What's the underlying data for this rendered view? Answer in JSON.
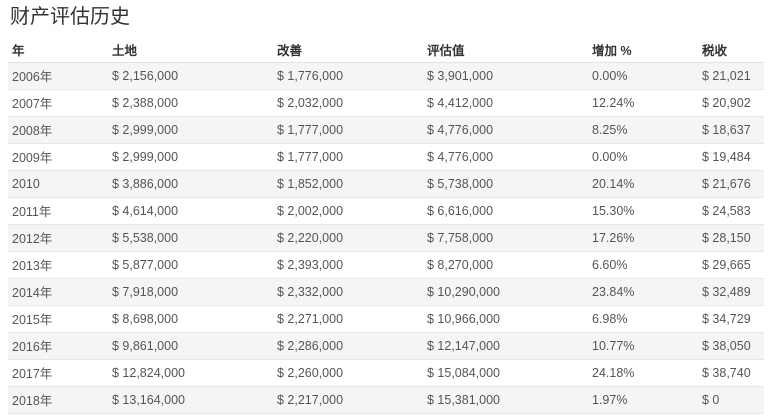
{
  "title": "财产评估历史",
  "columns": [
    "年",
    "土地",
    "改善",
    "评估值",
    "增加 %",
    "税收"
  ],
  "rows": [
    [
      "2006年",
      "$ 2,156,000",
      "$ 1,776,000",
      "$ 3,901,000",
      "0.00%",
      "$ 21,021"
    ],
    [
      "2007年",
      "$ 2,388,000",
      "$ 2,032,000",
      "$ 4,412,000",
      "12.24%",
      "$ 20,902"
    ],
    [
      "2008年",
      "$ 2,999,000",
      "$ 1,777,000",
      "$ 4,776,000",
      "8.25%",
      "$ 18,637"
    ],
    [
      "2009年",
      "$ 2,999,000",
      "$ 1,777,000",
      "$ 4,776,000",
      "0.00%",
      "$ 19,484"
    ],
    [
      "2010",
      "$ 3,886,000",
      "$ 1,852,000",
      "$ 5,738,000",
      "20.14%",
      "$ 21,676"
    ],
    [
      "2011年",
      "$ 4,614,000",
      "$ 2,002,000",
      "$ 6,616,000",
      "15.30%",
      "$ 24,583"
    ],
    [
      "2012年",
      "$ 5,538,000",
      "$ 2,220,000",
      "$ 7,758,000",
      "17.26%",
      "$ 28,150"
    ],
    [
      "2013年",
      "$ 5,877,000",
      "$ 2,393,000",
      "$ 8,270,000",
      "6.60%",
      "$ 29,665"
    ],
    [
      "2014年",
      "$ 7,918,000",
      "$ 2,332,000",
      "$ 10,290,000",
      "23.84%",
      "$ 32,489"
    ],
    [
      "2015年",
      "$ 8,698,000",
      "$ 2,271,000",
      "$ 10,966,000",
      "6.98%",
      "$ 34,729"
    ],
    [
      "2016年",
      "$ 9,861,000",
      "$ 2,286,000",
      "$ 12,147,000",
      "10.77%",
      "$ 38,050"
    ],
    [
      "2017年",
      "$ 12,824,000",
      "$ 2,260,000",
      "$ 15,084,000",
      "24.18%",
      "$ 38,740"
    ],
    [
      "2018年",
      "$ 13,164,000",
      "$ 2,217,000",
      "$ 15,381,000",
      "1.97%",
      "$ 0"
    ]
  ]
}
